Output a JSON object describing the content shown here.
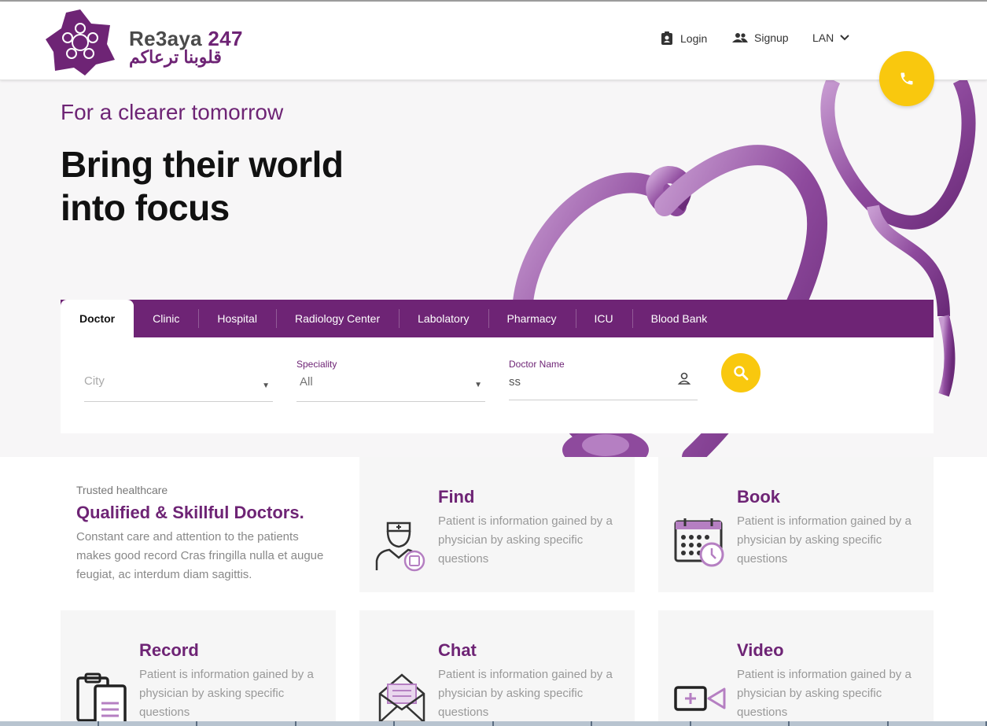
{
  "brand": {
    "name_latin": "Re3aya",
    "name_number": "247",
    "tagline_ar": "قلوبنا ترعاكم"
  },
  "nav": {
    "login": "Login",
    "signup": "Signup",
    "lan": "LAN"
  },
  "hero": {
    "subtitle": "For a clearer tomorrow",
    "title_line1": "Bring their world",
    "title_line2": "into focus"
  },
  "search": {
    "tabs": [
      "Doctor",
      "Clinic",
      "Hospital",
      "Radiology Center",
      "Labolatory",
      "Pharmacy",
      "ICU",
      "Blood Bank"
    ],
    "active_tab": "Doctor",
    "city": {
      "label": "",
      "placeholder": "City"
    },
    "speciality": {
      "label": "Speciality",
      "value": "All"
    },
    "doctor_name": {
      "label": "Doctor Name",
      "value": "ss"
    }
  },
  "features": {
    "intro_small": "Trusted healthcare",
    "intro_title": "Qualified & Skillful Doctors.",
    "intro_text": "Constant care and attention to the patients makes good record Cras fringilla nulla et augue feugiat, ac interdum diam sagittis.",
    "cards": [
      {
        "title": "Find",
        "text": "Patient is information gained by a physician by asking specific questions",
        "icon": "doctor-icon"
      },
      {
        "title": "Book",
        "text": "Patient is information gained by a physician by asking specific questions",
        "icon": "calendar-icon"
      },
      {
        "title": "Record",
        "text": "Patient is information gained by a physician by asking specific questions",
        "icon": "clipboard-icon"
      },
      {
        "title": "Chat",
        "text": "Patient is information gained by a physician by asking specific questions",
        "icon": "envelope-icon"
      },
      {
        "title": "Video",
        "text": "Patient is information gained by a physician by asking specific questions",
        "icon": "video-icon"
      }
    ]
  },
  "colors": {
    "brand_purple": "#6e2475",
    "accent_yellow": "#f9c80e"
  }
}
